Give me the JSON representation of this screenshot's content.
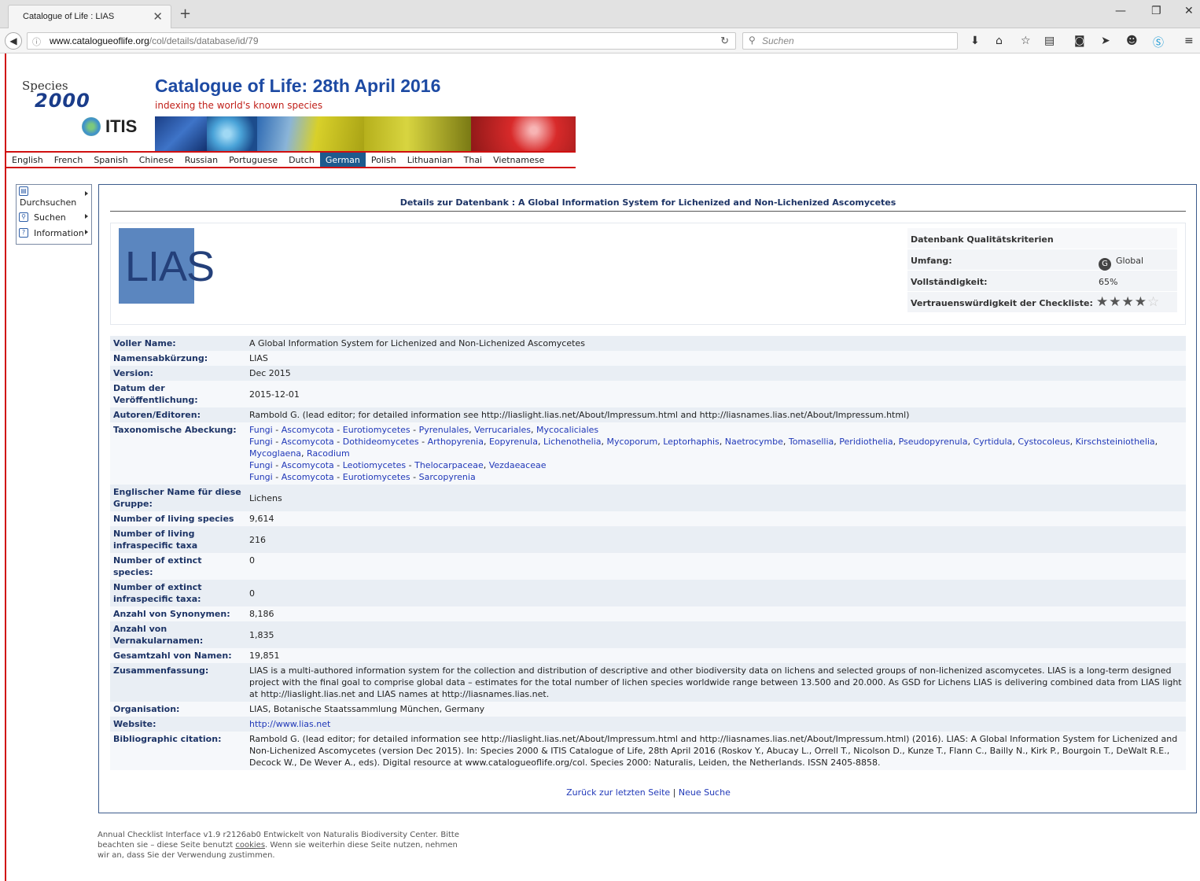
{
  "browser": {
    "tab_title": "Catalogue of Life : LIAS",
    "url_domain": "www.catalogueoflife.org",
    "url_path": "/col/details/database/id/79",
    "search_placeholder": "Suchen"
  },
  "header": {
    "logo_species": "Species",
    "logo_year": "2000",
    "logo_itis": "ITIS",
    "title": "Catalogue of Life: 28th April 2016",
    "tagline": "indexing the world's known species"
  },
  "languages": [
    "English",
    "French",
    "Spanish",
    "Chinese",
    "Russian",
    "Portuguese",
    "Dutch",
    "German",
    "Polish",
    "Lithuanian",
    "Thai",
    "Vietnamese"
  ],
  "active_language": "German",
  "sidemenu": {
    "browse": "Durchsuchen",
    "search": "Suchen",
    "info": "Information"
  },
  "main": {
    "heading": "Details zur Datenbank : A Global Information System for Lichenized and Non-Lichenized Ascomycetes",
    "logo_text": "LIAS",
    "quality": {
      "title": "Datenbank Qualitätskriterien",
      "scope_label": "Umfang:",
      "scope_value": "Global",
      "completeness_label": "Vollständigkeit:",
      "completeness_value": "65%",
      "confidence_label": "Vertrauenswürdigkeit der Checkliste:",
      "confidence_stars": 4,
      "confidence_max": 5
    },
    "rows": {
      "full_name_label": "Voller Name:",
      "full_name": "A Global Information System for Lichenized and Non-Lichenized Ascomycetes",
      "abbr_label": "Namensabkürzung:",
      "abbr": "LIAS",
      "version_label": "Version:",
      "version": "Dec 2015",
      "date_label": "Datum der Veröffentlichung:",
      "date": "2015-12-01",
      "authors_label": "Autoren/Editoren:",
      "authors": "Rambold G. (lead editor; for detailed information see http://liaslight.lias.net/About/Impressum.html and http://liasnames.lias.net/About/Impressum.html)",
      "taxonomic_label": "Taxonomische Abeckung:",
      "english_name_label": "Englischer Name für diese Gruppe:",
      "english_name": "Lichens",
      "living_species_label": "Number of living species",
      "living_species": "9,614",
      "living_infra_label": "Number of living infraspecific taxa",
      "living_infra": "216",
      "extinct_species_label": "Number of extinct species:",
      "extinct_species": "0",
      "extinct_infra_label": "Number of extinct infraspecific taxa:",
      "extinct_infra": "0",
      "synonyms_label": "Anzahl von Synonymen:",
      "synonyms": "8,186",
      "vernacular_label": "Anzahl von Vernakularnamen:",
      "vernacular": "1,835",
      "total_names_label": "Gesamtzahl von Namen:",
      "total_names": "19,851",
      "summary_label": "Zusammenfassung:",
      "summary": "LIAS is a multi-authored information system for the collection and distribution of descriptive and other biodiversity data on lichens and selected groups of non-lichenized ascomycetes. LIAS is a long-term designed project with the final goal to comprise global data – estimates for the total number of lichen species worldwide range between 13.500 and 20.000. As GSD for Lichens LIAS is delivering combined data from LIAS light at http://liaslight.lias.net and LIAS names at http://liasnames.lias.net.",
      "organisation_label": "Organisation:",
      "organisation": "LIAS, Botanische Staatssammlung München, Germany",
      "website_label": "Website:",
      "website": "http://www.lias.net",
      "citation_label": "Bibliographic citation:",
      "citation": "Rambold G. (lead editor; for detailed information see http://liaslight.lias.net/About/Impressum.html and http://liasnames.lias.net/About/Impressum.html) (2016). LIAS: A Global Information System for Lichenized and Non-Lichenized Ascomycetes (version Dec 2015). In: Species 2000 & ITIS Catalogue of Life, 28th April 2016 (Roskov Y., Abucay L., Orrell T., Nicolson D., Kunze T., Flann C., Bailly N., Kirk P., Bourgoin T., DeWalt R.E., Decock W., De Wever A., eds). Digital resource at www.catalogueoflife.org/col. Species 2000: Naturalis, Leiden, the Netherlands. ISSN 2405-8858."
    },
    "taxonomic_lines": [
      {
        "head": [
          "Fungi",
          "Ascomycota",
          "Eurotiomycetes"
        ],
        "tail": [
          "Pyrenulales",
          "Verrucariales",
          "Mycocaliciales"
        ]
      },
      {
        "head": [
          "Fungi",
          "Ascomycota",
          "Dothideomycetes"
        ],
        "tail": [
          "Arthopyrenia",
          "Eopyrenula",
          "Lichenothelia",
          "Mycoporum",
          "Leptorhaphis",
          "Naetrocymbe",
          "Tomasellia",
          "Peridiothelia",
          "Pseudopyrenula",
          "Cyrtidula",
          "Cystocoleus",
          "Kirschsteiniothelia",
          "Mycoglaena",
          "Racodium"
        ]
      },
      {
        "head": [
          "Fungi",
          "Ascomycota",
          "Leotiomycetes"
        ],
        "tail": [
          "Thelocarpaceae",
          "Vezdaeaceae"
        ]
      },
      {
        "head": [
          "Fungi",
          "Ascomycota",
          "Eurotiomycetes"
        ],
        "tail": [
          "Sarcopyrenia"
        ]
      }
    ],
    "back_link": "Zurück zur letzten Seite",
    "link_separator": "|",
    "new_search_link": "Neue Suche"
  },
  "footer": {
    "text_before": "Annual Checklist Interface v1.9 r2126ab0 Entwickelt von Naturalis Biodiversity Center. Bitte beachten sie – diese Seite benutzt ",
    "cookies_link": "cookies",
    "text_after": ". Wenn sie weiterhin diese Seite nutzen, nehmen wir an, dass Sie der Verwendung zustimmen."
  }
}
